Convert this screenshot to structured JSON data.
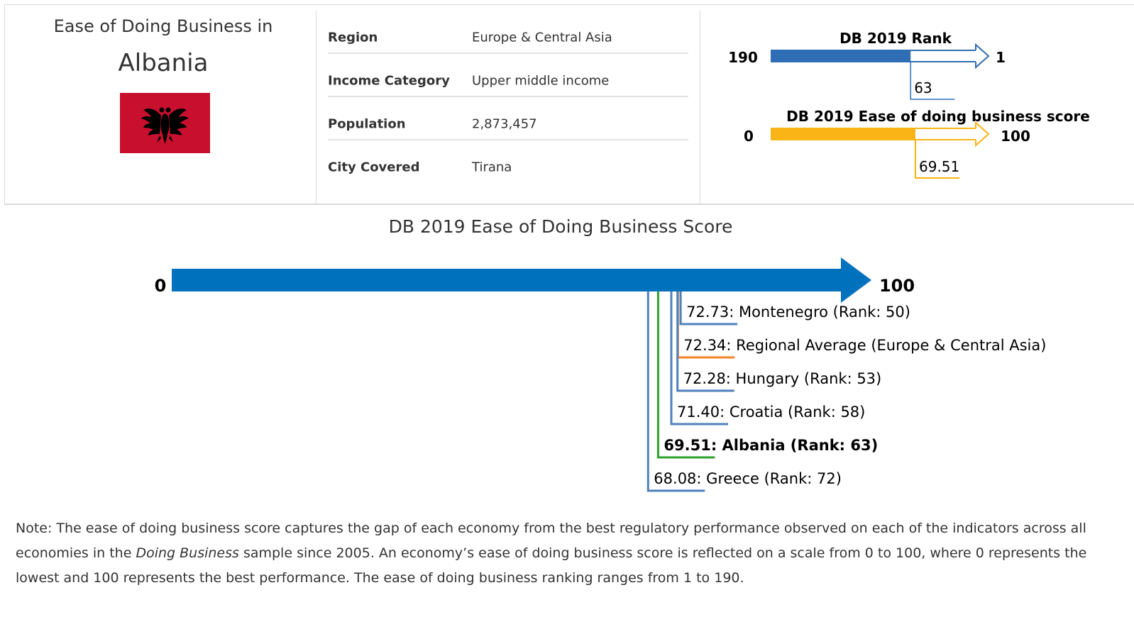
{
  "header": {
    "heading": "Ease of Doing Business in",
    "country": "Albania"
  },
  "flag": {
    "icon": "albania-flag-icon",
    "color_bg": "#c8102e",
    "color_eagle": "#000000"
  },
  "info": [
    {
      "label": "Region",
      "value": "Europe & Central Asia"
    },
    {
      "label": "Income Category",
      "value": "Upper middle income"
    },
    {
      "label": "Population",
      "value": "2,873,457"
    },
    {
      "label": "City Covered",
      "value": "Tirana"
    }
  ],
  "rank_gauge": {
    "title": "DB 2019 Rank",
    "min_label": "190",
    "max_label": "1",
    "min": 190,
    "max": 1,
    "value": 63,
    "value_label": "63",
    "color": "#2f6eb5"
  },
  "score_gauge": {
    "title": "DB 2019 Ease of doing business score",
    "min_label": "0",
    "max_label": "100",
    "min": 0,
    "max": 100,
    "value": 69.51,
    "value_label": "69.51",
    "color": "#fbb416"
  },
  "chart_data": {
    "type": "bar",
    "title": "DB 2019 Ease of Doing Business Score",
    "min_label": "0",
    "max_label": "100",
    "xlim": [
      0,
      100
    ],
    "bar_color": "#0071bc",
    "entries": [
      {
        "label": "72.73: Montenegro (Rank: 50)",
        "value": 72.73,
        "color": "#4f81bd",
        "bold": false
      },
      {
        "label": "72.34: Regional Average (Europe & Central Asia)",
        "value": 72.34,
        "color": "#f58220",
        "bold": false
      },
      {
        "label": "72.28: Hungary (Rank: 53)",
        "value": 72.28,
        "color": "#4f81bd",
        "bold": false
      },
      {
        "label": "71.40: Croatia (Rank: 58)",
        "value": 71.4,
        "color": "#4f81bd",
        "bold": false
      },
      {
        "label": "69.51: Albania (Rank: 63)",
        "value": 69.51,
        "color": "#2ca02c",
        "bold": true
      },
      {
        "label": "68.08: Greece (Rank: 72)",
        "value": 68.08,
        "color": "#4f81bd",
        "bold": false
      }
    ]
  },
  "note": {
    "prefix": "Note: The ease of doing business score captures the gap of each economy from the best regulatory performance observed on each of the indicators across all economies in the ",
    "emphasis": "Doing Business",
    "suffix": " sample since 2005. An economy’s ease of doing business score is reflected on a scale from 0 to 100, where 0 represents the lowest and 100 represents the best performance. The ease of doing business ranking ranges from 1 to 190."
  }
}
